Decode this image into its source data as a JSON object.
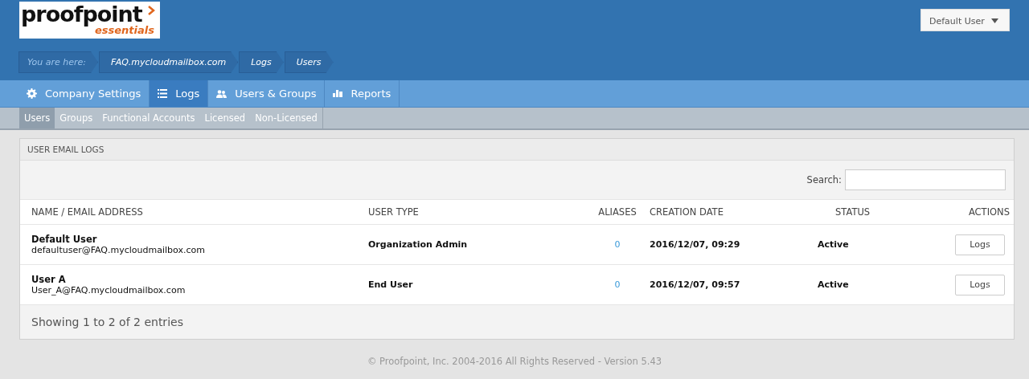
{
  "logo": {
    "name": "proofpoint",
    "tagline": "essentials"
  },
  "user_menu": {
    "label": "Default User"
  },
  "breadcrumb": {
    "prefix": "You are here:",
    "items": [
      "FAQ.mycloudmailbox.com",
      "Logs",
      "Users"
    ]
  },
  "nav": [
    {
      "label": "Company Settings",
      "selected": false
    },
    {
      "label": "Logs",
      "selected": true
    },
    {
      "label": "Users & Groups",
      "selected": false
    },
    {
      "label": "Reports",
      "selected": false
    }
  ],
  "subnav": [
    {
      "label": "Users",
      "selected": true
    },
    {
      "label": "Groups",
      "selected": false
    },
    {
      "label": "Functional Accounts",
      "selected": false
    },
    {
      "label": "Licensed",
      "selected": false
    },
    {
      "label": "Non-Licensed",
      "selected": false
    }
  ],
  "panel": {
    "title": "USER EMAIL LOGS",
    "search_label": "Search:",
    "columns": [
      "NAME / EMAIL ADDRESS",
      "USER TYPE",
      "ALIASES",
      "CREATION DATE",
      "STATUS",
      "ACTIONS"
    ],
    "rows": [
      {
        "name": "Default User",
        "email": "defaultuser@FAQ.mycloudmailbox.com",
        "user_type": "Organization Admin",
        "aliases": "0",
        "creation_date": "2016/12/07, 09:29",
        "status": "Active",
        "action": "Logs"
      },
      {
        "name": "User A",
        "email": "User_A@FAQ.mycloudmailbox.com",
        "user_type": "End User",
        "aliases": "0",
        "creation_date": "2016/12/07, 09:57",
        "status": "Active",
        "action": "Logs"
      }
    ],
    "summary": "Showing 1 to 2 of 2 entries"
  },
  "footer": "© Proofpoint, Inc. 2004-2016 All Rights Reserved - Version 5.43"
}
